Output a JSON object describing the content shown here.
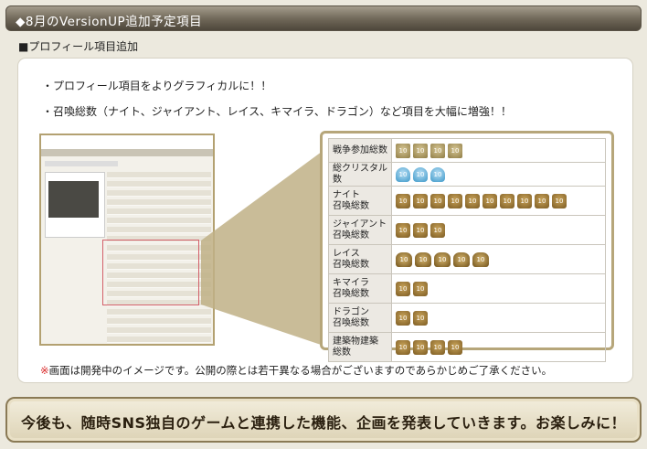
{
  "header": {
    "title": "◆8月のVersionUP追加予定項目"
  },
  "section": {
    "label": "■プロフィール項目追加"
  },
  "bullets": [
    "・プロフィール項目をよりグラフィカルに！！",
    "・召喚総数（ナイト、ジャイアント、レイス、キマイラ、ドラゴン）など項目を大幅に増強！！"
  ],
  "profile_table": {
    "rows": [
      {
        "label": "戦争参加総数",
        "icons": [
          "sword",
          "sword",
          "sword",
          "sword"
        ],
        "count_label": "10"
      },
      {
        "label": "総クリスタル数",
        "icons": [
          "blue",
          "blue",
          "blue"
        ],
        "count_label": "10"
      },
      {
        "label": "ナイト\n召喚総数",
        "icons": [
          "knight",
          "knight",
          "knight",
          "knight",
          "knight",
          "knight",
          "knight",
          "knight",
          "knight",
          "knight"
        ],
        "count_label": "10"
      },
      {
        "label": "ジャイアント\n召喚総数",
        "icons": [
          "giant",
          "giant",
          "giant"
        ],
        "count_label": "10"
      },
      {
        "label": "レイス\n召喚総数",
        "icons": [
          "wing",
          "wing",
          "wing",
          "wing",
          "wing"
        ],
        "count_label": "10"
      },
      {
        "label": "キマイラ\n召喚総数",
        "icons": [
          "chimera",
          "chimera"
        ],
        "count_label": "10"
      },
      {
        "label": "ドラゴン\n召喚総数",
        "icons": [
          "dragon",
          "dragon"
        ],
        "count_label": "10"
      },
      {
        "label": "建築物建築\n総数",
        "icons": [
          "building",
          "building",
          "building",
          "building"
        ],
        "count_label": "10"
      }
    ]
  },
  "note": {
    "asterisk": "※",
    "text": "画面は開発中のイメージです。公開の際とは若干異なる場合がございますのであらかじめご了承ください。"
  },
  "banner": {
    "text": "今後も、随時SNS独自のゲームと連携した機能、企画を発表していきます。お楽しみに！"
  },
  "colors": {
    "header_bg": "#6e6657",
    "gold_border": "#b6a67a",
    "note_red": "#d92a2a"
  }
}
